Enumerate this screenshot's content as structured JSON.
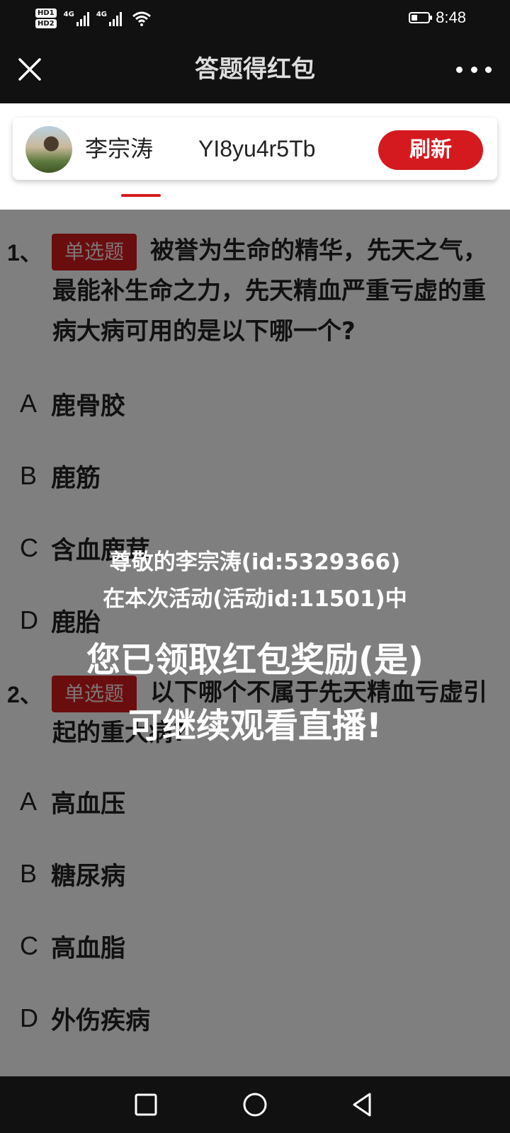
{
  "status_bar": {
    "hd1": "HD1",
    "hd2": "HD2",
    "sim1": "4G",
    "sim2": "4G",
    "time": "8:48",
    "battery_level": 0.35
  },
  "header": {
    "title": "答题得红包"
  },
  "user_card": {
    "name": "李宗涛",
    "code": "YI8yu4r5Tb",
    "refresh_label": "刷新"
  },
  "questions": [
    {
      "number": "1、",
      "type_badge": "单选题",
      "text": "被誉为生命的精华，先天之气，最能补生命之力，先天精血严重亏虚的重病大病可用的是以下哪一个?",
      "options": [
        {
          "letter": "A",
          "text": "鹿骨胶"
        },
        {
          "letter": "B",
          "text": "鹿筋"
        },
        {
          "letter": "C",
          "text": "含血鹿茸"
        },
        {
          "letter": "D",
          "text": "鹿胎"
        }
      ]
    },
    {
      "number": "2、",
      "type_badge": "单选题",
      "text": "以下哪个不属于先天精血亏虚引起的重大病?",
      "options": [
        {
          "letter": "A",
          "text": "高血压"
        },
        {
          "letter": "B",
          "text": "糖尿病"
        },
        {
          "letter": "C",
          "text": "高血脂"
        },
        {
          "letter": "D",
          "text": "外伤疾病"
        }
      ]
    }
  ],
  "overlay": {
    "line1": "尊敬的李宗涛(id:5329366)",
    "line2": "在本次活动(活动id:11501)中",
    "line3": "您已领取红包奖励(是)",
    "line4": "可继续观看直播!"
  },
  "colors": {
    "accent": "#d41a1f",
    "topbar": "#111111"
  }
}
